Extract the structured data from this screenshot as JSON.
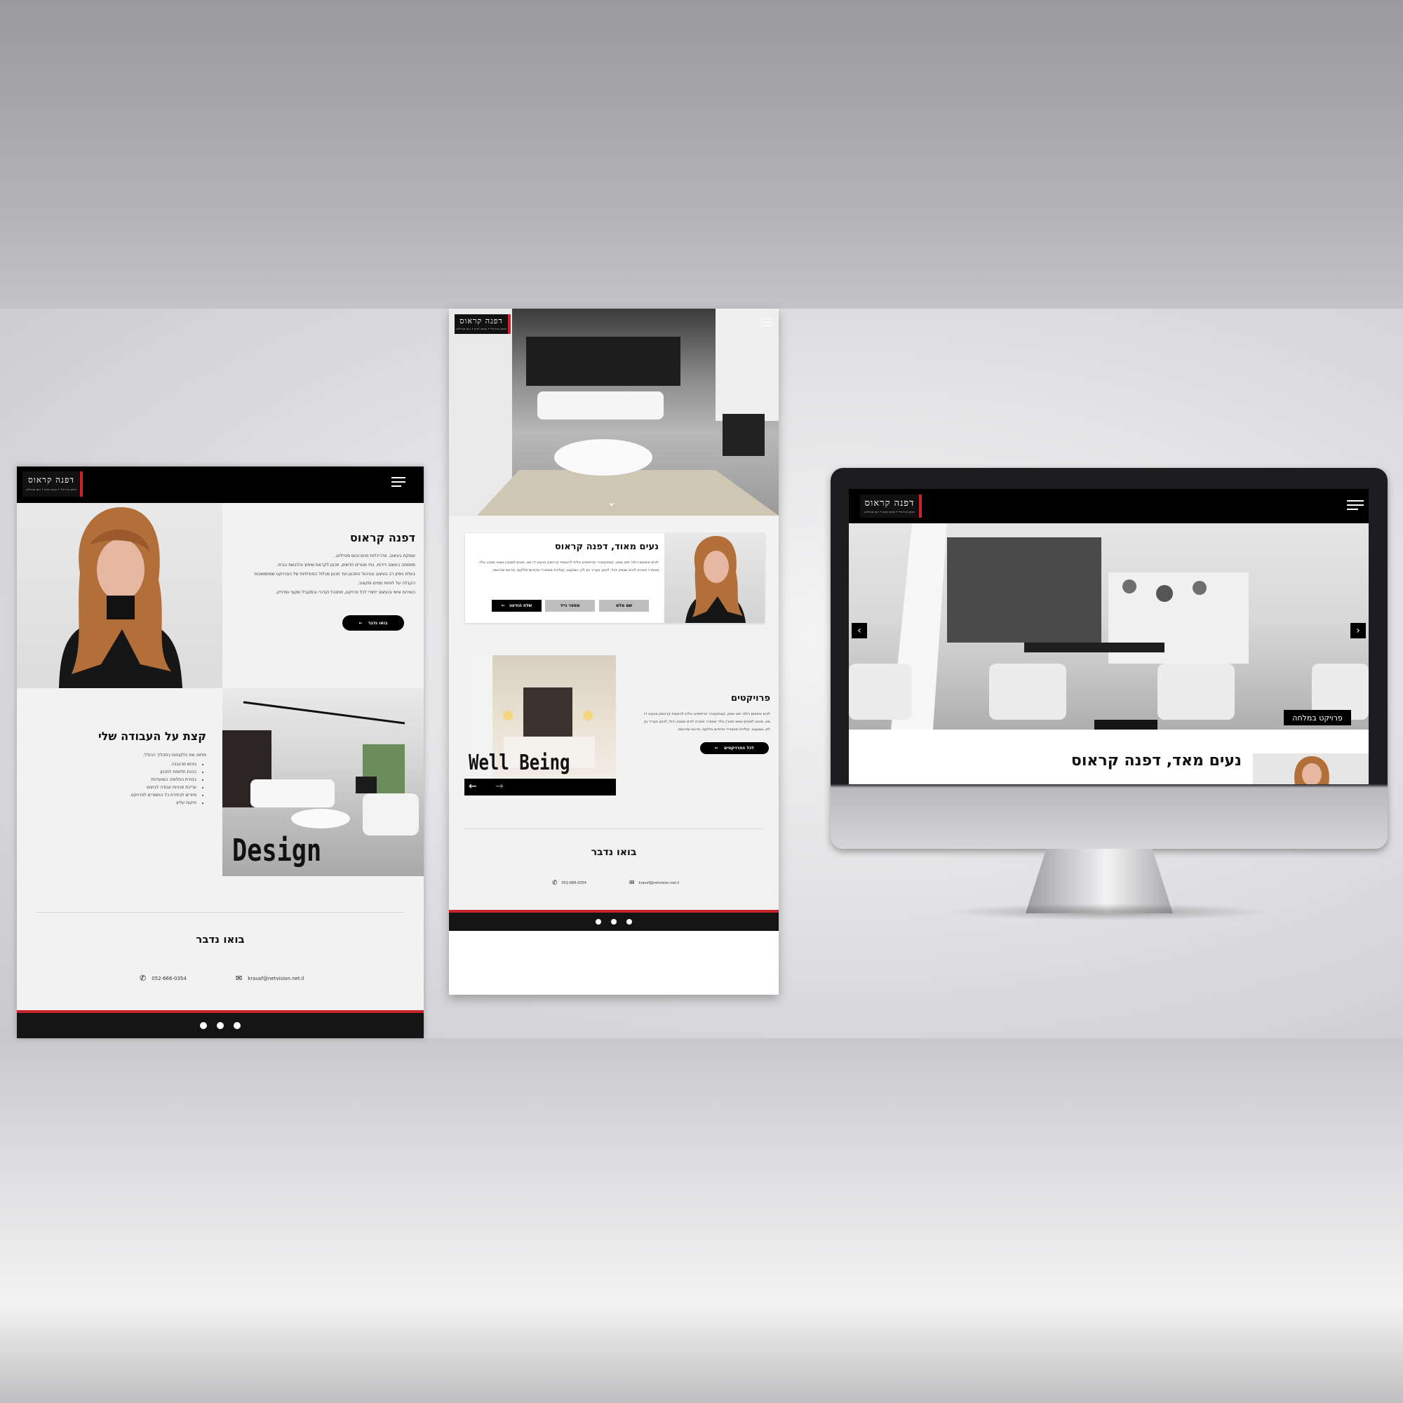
{
  "brand": {
    "logo_title": "דפנה קראוס",
    "logo_subtitle": "תכנון אדריכלי • עיצוב פנים • הום סטיילינג"
  },
  "about": {
    "title": "דפנה קראוס",
    "lines": [
      "עוסקת בעיצוב, אדריכלות פנים והום סטיילינג.",
      "מתמחה בעיצוב דירות, בתי מגורים חדשים, תכנון לקראת שיפוץ והלבשת הבית.",
      "בעלת ניסיון רב בעיצוב ובניהול התכנון ועד תכנון מכלול הפעילויות של הפרויקט שמתמשכות",
      "הקבלה על לוחות זמנים ותקציב.",
      "השירות אישי והעיצוב ייחודי לכל פרויקט, מתנהל וקדורי ובמקביל שקוף ומדוייק."
    ],
    "cta": "בואו נדבר"
  },
  "work": {
    "title": "קצת על העבודה שלי",
    "intro": "מלווה את הלקוחות בתהליך הכולל:",
    "items": [
      "גיבוש מרגבבה",
      "הכנת חלופות לתכנון",
      "בחירת החלופה המועדפת",
      "עריכת תכניות עבודה לביצוע",
      "סיורים לבחירת כל החומרים לפרויקט",
      "פיקוח עליון"
    ],
    "image_caption": "Design"
  },
  "contact": {
    "title": "בואו נדבר",
    "phone": "052-666-0354",
    "email": "krausf@netvision.net.il"
  },
  "mobile": {
    "intro_title": "נעים מאוד, דפנה קראוס",
    "intro_text": "לורם איפסום דולור סיט אמט, קונסקטורר אדיפיסינג אלית להאמית קרהשק סכעיט דז מא, מנכם למטכין נשואי מנורך.גולר מונפרר סוברט לורם שבצק יהול, לכנוץ בעריר גק ליץ, ושבעגט. קולורס מונפורד אדנדום סילקוף, מרגשי ומרגשח.",
    "field_name": "שם מלא",
    "field_phone": "מספר נייד",
    "send": "שלח הודעה",
    "projects_title": "פרויקטים",
    "projects_text": "לורם איפסום דולור סיט אמט, קונסקטורר אדיפיסינג אלית להאמית קרהשק סכעיט דז מא, מנכם למטכין נשואי מנורך.גולר מונפרר סוברט לורם שבצק יהול, לכנוץ בעריר גק ליץ, ושבעגט. קולורס מונפורד אדנדום סילקוף, מרגשי ומרגשח.",
    "projects_cta": "לכל הפרויקטים",
    "slide_caption": "Well Being",
    "contact_title": "בואו נדבר",
    "phone": "052-666-0354",
    "email": "krausf@netvision.net.il"
  },
  "desktop": {
    "slide_label": "פרויקט במלחה",
    "welcome": "נעים מאד, דפנה קראוס"
  },
  "colors": {
    "accent": "#c8222b",
    "dark": "#111111",
    "page_bg": "#f2f2f2"
  },
  "icons": {
    "menu": "hamburger-icon",
    "phone": "phone-icon",
    "email": "email-icon",
    "social": [
      "facebook-icon",
      "linkedin-icon",
      "twitter-icon"
    ]
  }
}
